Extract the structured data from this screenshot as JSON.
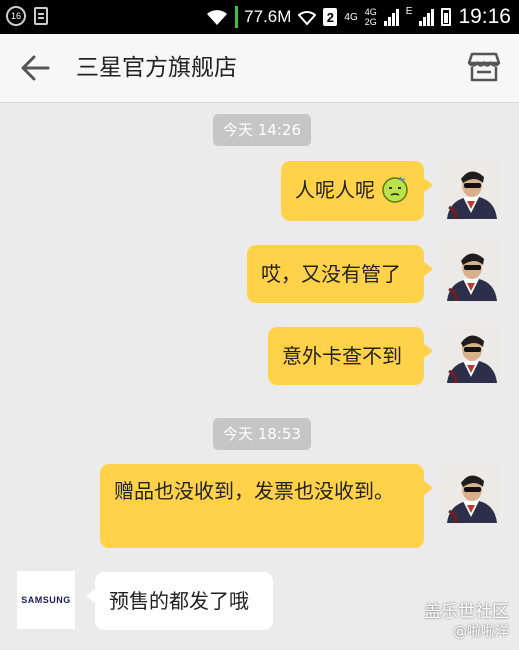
{
  "status_bar": {
    "notification_count": "16",
    "net_speed": "77.6M",
    "sim_label": "2",
    "net_4g": "4G",
    "net_4g2g_top": "4G",
    "net_4g2g_bottom": "2G",
    "net_e": "E",
    "time": "19:16"
  },
  "header": {
    "title": "三星官方旗舰店"
  },
  "messages": {
    "time_1": "今天 14:26",
    "msg_1": "人呢人呢",
    "msg_2": "哎，又没有管了",
    "msg_3": "意外卡查不到",
    "time_2": "今天 18:53",
    "msg_4": "赠品也没收到，发票也没收到。",
    "msg_5": "预售的都发了哦"
  },
  "merchant": {
    "logo_text": "SAMSUNG"
  },
  "watermark": {
    "title": "盖乐世社区",
    "handle": "@啦啦洋"
  },
  "colors": {
    "outgoing_bubble": "#ffd24a",
    "incoming_bubble": "#ffffff",
    "background": "#ebebeb"
  }
}
